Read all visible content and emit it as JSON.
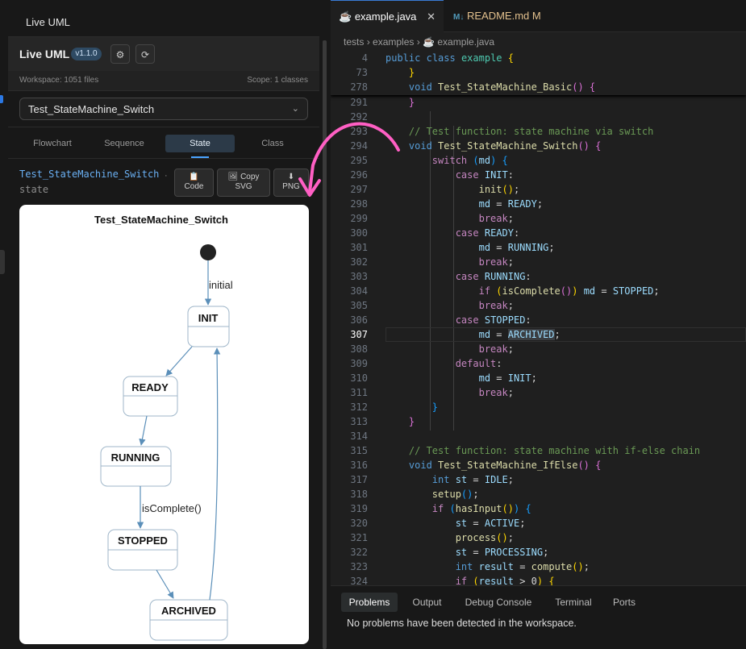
{
  "sidebar": {
    "view_title": "Live UML",
    "header_title": "Live UML",
    "version": "v1.1.0",
    "workspace": "Workspace: 1051 files",
    "scope": "Scope: 1 classes",
    "function_selected": "Test_StateMachine_Switch",
    "tabs": [
      "Flowchart",
      "Sequence",
      "State",
      "Class"
    ],
    "active_tab": "State",
    "func_name": "Test_StateMachine_Switch",
    "diagram_kind": "state",
    "separator": "·",
    "actions": [
      {
        "icon": "clipboard-icon",
        "glyph": "📋",
        "label": "Code"
      },
      {
        "icon": "image-icon",
        "glyph": "🖼",
        "label": "Copy SVG"
      },
      {
        "icon": "download-icon",
        "glyph": "⬇",
        "label": "PNG"
      }
    ]
  },
  "diagram": {
    "title": "Test_StateMachine_Switch",
    "states": [
      "INIT",
      "READY",
      "RUNNING",
      "STOPPED",
      "ARCHIVED"
    ],
    "transitions": [
      {
        "from": "start",
        "to": "INIT",
        "label": "initial"
      },
      {
        "from": "INIT",
        "to": "READY",
        "label": ""
      },
      {
        "from": "READY",
        "to": "RUNNING",
        "label": ""
      },
      {
        "from": "RUNNING",
        "to": "STOPPED",
        "label": "isComplete()"
      },
      {
        "from": "STOPPED",
        "to": "ARCHIVED",
        "label": ""
      },
      {
        "from": "ARCHIVED",
        "to": "INIT",
        "label": ""
      }
    ],
    "colors": {
      "edge": "#5b8fb9",
      "node_border": "#9fb6c9"
    }
  },
  "editor": {
    "tabs": [
      {
        "label": "example.java",
        "icon": "java-icon"
      },
      {
        "label": "README.md",
        "icon": "markdown-icon",
        "status": "M"
      }
    ],
    "breadcrumb": [
      "tests",
      "examples",
      "example.java"
    ],
    "sticky_lines": [
      {
        "n": "4",
        "html": "<span class='kb'>public</span> <span class='kb'>class</span> <span class='ty'>example</span> <span class='p1'>{</span>"
      },
      {
        "n": "73",
        "html": "    <span class='p1'>}</span>"
      },
      {
        "n": "278",
        "html": "    <span class='kb'>void</span> <span class='f'>Test_StateMachine_Basic</span><span class='p2'>()</span> <span class='p2'>{</span>"
      }
    ],
    "lines": [
      {
        "n": "291",
        "html": "    <span class='p2'>}</span>"
      },
      {
        "n": "292",
        "html": ""
      },
      {
        "n": "293",
        "html": "    <span class='c'>// Test function: state machine via switch</span>"
      },
      {
        "n": "294",
        "html": "    <span class='kb'>void</span> <span class='f'>Test_StateMachine_Switch</span><span class='p2'>()</span> <span class='p2'>{</span>"
      },
      {
        "n": "295",
        "html": "        <span class='k'>switch</span> <span class='p3'>(</span><span class='v'>md</span><span class='p3'>)</span> <span class='p3'>{</span>"
      },
      {
        "n": "296",
        "html": "            <span class='k'>case</span> <span class='v'>INIT</span>:"
      },
      {
        "n": "297",
        "html": "                <span class='f'>init</span><span class='p1'>()</span>;"
      },
      {
        "n": "298",
        "html": "                <span class='v'>md</span> = <span class='v'>READY</span>;"
      },
      {
        "n": "299",
        "html": "                <span class='k'>break</span>;"
      },
      {
        "n": "300",
        "html": "            <span class='k'>case</span> <span class='v'>READY</span>:"
      },
      {
        "n": "301",
        "html": "                <span class='v'>md</span> = <span class='v'>RUNNING</span>;"
      },
      {
        "n": "302",
        "html": "                <span class='k'>break</span>;"
      },
      {
        "n": "303",
        "html": "            <span class='k'>case</span> <span class='v'>RUNNING</span>:"
      },
      {
        "n": "304",
        "html": "                <span class='k'>if</span> <span class='p1'>(</span><span class='f'>isComplete</span><span class='p2'>()</span><span class='p1'>)</span> <span class='v'>md</span> = <span class='v'>STOPPED</span>;"
      },
      {
        "n": "305",
        "html": "                <span class='k'>break</span>;"
      },
      {
        "n": "306",
        "html": "            <span class='k'>case</span> <span class='v'>STOPPED</span>:"
      },
      {
        "n": "307",
        "html": "                <span class='v'>md</span> = <span class='v hl'>ARCHIVED</span>;"
      },
      {
        "n": "308",
        "html": "                <span class='k'>break</span>;"
      },
      {
        "n": "309",
        "html": "            <span class='k'>default</span>:"
      },
      {
        "n": "310",
        "html": "                <span class='v'>md</span> = <span class='v'>INIT</span>;"
      },
      {
        "n": "311",
        "html": "                <span class='k'>break</span>;"
      },
      {
        "n": "312",
        "html": "        <span class='p3'>}</span>"
      },
      {
        "n": "313",
        "html": "    <span class='p2'>}</span>"
      },
      {
        "n": "314",
        "html": ""
      },
      {
        "n": "315",
        "html": "    <span class='c'>// Test function: state machine with if-else chain</span>"
      },
      {
        "n": "316",
        "html": "    <span class='kb'>void</span> <span class='f'>Test_StateMachine_IfElse</span><span class='p2'>()</span> <span class='p2'>{</span>"
      },
      {
        "n": "317",
        "html": "        <span class='kb'>int</span> <span class='v'>st</span> = <span class='v'>IDLE</span>;"
      },
      {
        "n": "318",
        "html": "        <span class='f'>setup</span><span class='p3'>()</span>;"
      },
      {
        "n": "319",
        "html": "        <span class='k'>if</span> <span class='p3'>(</span><span class='f'>hasInput</span><span class='p1'>()</span><span class='p3'>)</span> <span class='p3'>{</span>"
      },
      {
        "n": "320",
        "html": "            <span class='v'>st</span> = <span class='v'>ACTIVE</span>;"
      },
      {
        "n": "321",
        "html": "            <span class='f'>process</span><span class='p1'>()</span>;"
      },
      {
        "n": "322",
        "html": "            <span class='v'>st</span> = <span class='v'>PROCESSING</span>;"
      },
      {
        "n": "323",
        "html": "            <span class='kb'>int</span> <span class='v'>result</span> = <span class='f'>compute</span><span class='p1'>()</span>;"
      },
      {
        "n": "324",
        "html": "            <span class='k'>if</span> <span class='p1'>(</span><span class='v'>result</span> &gt; 0<span class='p1'>)</span> <span class='p1'>{</span>"
      }
    ],
    "current_line": "307",
    "panel_tabs": [
      "Problems",
      "Output",
      "Debug Console",
      "Terminal",
      "Ports"
    ],
    "panel_active": "Problems",
    "panel_message": "No problems have been detected in the workspace."
  }
}
